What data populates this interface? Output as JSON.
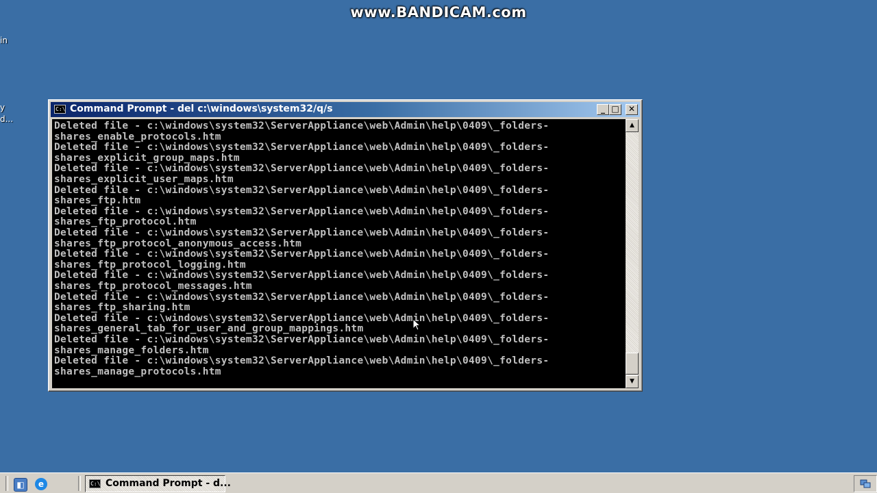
{
  "watermark": "www.BANDICAM.com",
  "desktop_fragments": [
    "in",
    "y",
    "d..."
  ],
  "window": {
    "title": "Command Prompt - del c:\\windows\\system32/q/s",
    "icon": "command-prompt-icon",
    "buttons": {
      "minimize": "minimize-icon",
      "maximize": "maximize-icon",
      "close": "close-icon"
    }
  },
  "console": {
    "lines": [
      "Deleted file - c:\\windows\\system32\\ServerAppliance\\web\\Admin\\help\\0409\\_folders-",
      "shares_enable_protocols.htm",
      "Deleted file - c:\\windows\\system32\\ServerAppliance\\web\\Admin\\help\\0409\\_folders-",
      "shares_explicit_group_maps.htm",
      "Deleted file - c:\\windows\\system32\\ServerAppliance\\web\\Admin\\help\\0409\\_folders-",
      "shares_explicit_user_maps.htm",
      "Deleted file - c:\\windows\\system32\\ServerAppliance\\web\\Admin\\help\\0409\\_folders-",
      "shares_ftp.htm",
      "Deleted file - c:\\windows\\system32\\ServerAppliance\\web\\Admin\\help\\0409\\_folders-",
      "shares_ftp_protocol.htm",
      "Deleted file - c:\\windows\\system32\\ServerAppliance\\web\\Admin\\help\\0409\\_folders-",
      "shares_ftp_protocol_anonymous_access.htm",
      "Deleted file - c:\\windows\\system32\\ServerAppliance\\web\\Admin\\help\\0409\\_folders-",
      "shares_ftp_protocol_logging.htm",
      "Deleted file - c:\\windows\\system32\\ServerAppliance\\web\\Admin\\help\\0409\\_folders-",
      "shares_ftp_protocol_messages.htm",
      "Deleted file - c:\\windows\\system32\\ServerAppliance\\web\\Admin\\help\\0409\\_folders-",
      "shares_ftp_sharing.htm",
      "Deleted file - c:\\windows\\system32\\ServerAppliance\\web\\Admin\\help\\0409\\_folders-",
      "shares_general_tab_for_user_and_group_mappings.htm",
      "Deleted file - c:\\windows\\system32\\ServerAppliance\\web\\Admin\\help\\0409\\_folders-",
      "shares_manage_folders.htm",
      "Deleted file - c:\\windows\\system32\\ServerAppliance\\web\\Admin\\help\\0409\\_folders-",
      "shares_manage_protocols.htm"
    ]
  },
  "taskbar": {
    "quick_launch": [
      "server-manager-icon",
      "internet-explorer-icon"
    ],
    "task_label": "Command Prompt - d...",
    "tray_icon": "network-tray-icon"
  },
  "colors": {
    "desktop": "#3a6ea5",
    "console_bg": "#000000",
    "console_fg": "#c0c0c0",
    "title_start": "#0a246a",
    "title_end": "#a6caf0"
  }
}
